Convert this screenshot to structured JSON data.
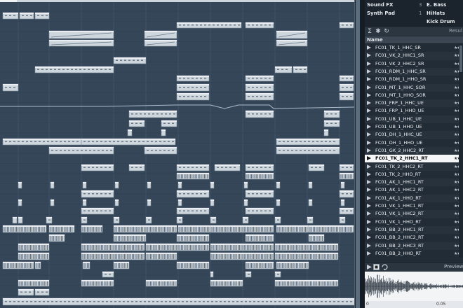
{
  "mediabay": {
    "attributes": [
      {
        "name": "Sound FX",
        "count": "3",
        "value": "E. Bass"
      },
      {
        "name": "Synth Pad",
        "count": "1",
        "value": "HiHats"
      },
      {
        "name": "",
        "count": "",
        "value": "Kick Drum"
      }
    ],
    "results_label": "Resul",
    "column_header": "Name",
    "stars": "★★★",
    "results": [
      "FC01_TK_1_HHC_SR",
      "FC01_VK_2_HHC1_SR",
      "FC01_VK_2_HHC2_SR",
      "FC01_RDM_1_HHC_SR",
      "FC01_RDM_1_HHO_SR",
      "FC01_MT_1_HHC_SOR",
      "FC01_MT_1_HHO_SOR",
      "FC01_FRP_1_HHC_UE",
      "FC01_FRP_1_HHO_UE",
      "FC01_UB_1_HHC_UE",
      "FC01_UB_1_HHO_UE",
      "FC01_DH_1_HHC_UE",
      "FC01_DH_1_HHO_UE",
      "FC01_GK_2_HHC2_RT",
      "FC01_TK_2_HHC1_RT",
      "FC01_TK_2_HHC2_RT",
      "FC01_TK_2_HHO_RT",
      "FC01_AK_1_HHC1_RT",
      "FC01_AK_1_HHC2_RT",
      "FC01_AK_1_HHO_RT",
      "FC01_VK_1_HHC1_RT",
      "FC01_VK_1_HHC2_RT",
      "FC01_VK_1_HHO_RT",
      "FC01_BB_2_HHC1_RT",
      "FC01_BB_2_HHC2_RT",
      "FC01_BB_2_HHC3_RT",
      "FC01_BB_2_HHO_RT"
    ],
    "selected_index": 14,
    "preview_label": "Preview",
    "ruler": {
      "start": "0",
      "mark": "0.05"
    }
  },
  "icons": {
    "sum": "sum-icon",
    "settings": "gear-icon",
    "refresh": "refresh-icon",
    "play": "play-icon",
    "stop": "stop-icon",
    "loop": "loop-icon"
  },
  "colors": {
    "arrange_bg": "#344658",
    "part_fill": "#cdd5dd",
    "selected_row": "#f4f6f8"
  }
}
